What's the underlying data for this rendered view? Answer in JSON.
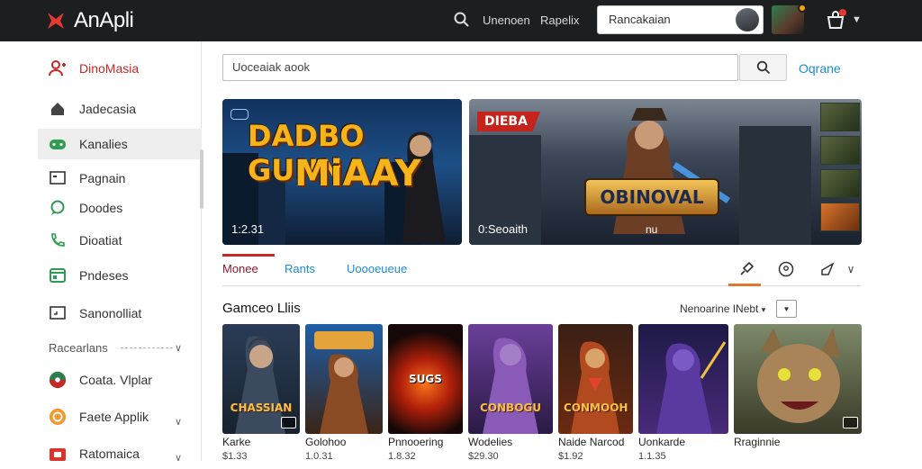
{
  "app": {
    "name": "AnApli",
    "brand_color": "#e53935"
  },
  "topbar": {
    "links": [
      "Unenoen",
      "Rapelix"
    ],
    "search_value": "Rancakaian"
  },
  "sidebar": {
    "items": [
      {
        "label": "DinoMasia",
        "icon": "add-user-icon"
      },
      {
        "label": "Jadecasia",
        "icon": "home-icon"
      },
      {
        "label": "Kanalies",
        "icon": "gamepad-icon"
      },
      {
        "label": "Pagnain",
        "icon": "window-icon"
      },
      {
        "label": "Doodes",
        "icon": "chat-icon"
      },
      {
        "label": "Dioatiat",
        "icon": "phone-icon"
      },
      {
        "label": "Pndeses",
        "icon": "calendar-icon"
      },
      {
        "label": "Sanonolliat",
        "icon": "monitor-icon"
      }
    ],
    "section_label": "Racearlans",
    "sub_items": [
      {
        "label": "Coata. Vlplar",
        "icon": "globe-icon"
      },
      {
        "label": "Faete Applik",
        "icon": "app-icon"
      },
      {
        "label": "Ratomaica",
        "icon": "shop-icon"
      }
    ]
  },
  "search": {
    "placeholder": "Uoceaiak aook",
    "link": "Oqrane"
  },
  "banners": [
    {
      "title_line1": "DADBO GUNN",
      "title_line2": "MiAAY",
      "time": "1:2.31"
    },
    {
      "tag": "DIEBA",
      "emblem": "OBINOVAL",
      "time": "0:Seoaith",
      "meta": "nu"
    }
  ],
  "tabs": [
    {
      "label": "Monee",
      "active": true
    },
    {
      "label": "Rants",
      "active": false
    },
    {
      "label": "Uoooeueue",
      "active": false
    }
  ],
  "section": {
    "title": "Gamceo Lliis",
    "sort_label": "Nenoarine INebt"
  },
  "cards": [
    {
      "name": "Karke",
      "price": "$1.33",
      "art_title": "CHASSIAN"
    },
    {
      "name": "Golohoo",
      "price": "1.0.31",
      "art_title": ""
    },
    {
      "name": "Pnnooering",
      "price": "1.8.32",
      "art_title": "SUGS"
    },
    {
      "name": "Wodelies",
      "price": "$29.30",
      "art_title": "CONBOGU"
    },
    {
      "name": "Naide Narcod",
      "price": "$1.92",
      "art_title": "CONMOOH"
    },
    {
      "name": "Uonkarde",
      "price": "1.1.35",
      "art_title": ""
    },
    {
      "name": "Rraginnie",
      "price": "",
      "art_title": ""
    }
  ]
}
